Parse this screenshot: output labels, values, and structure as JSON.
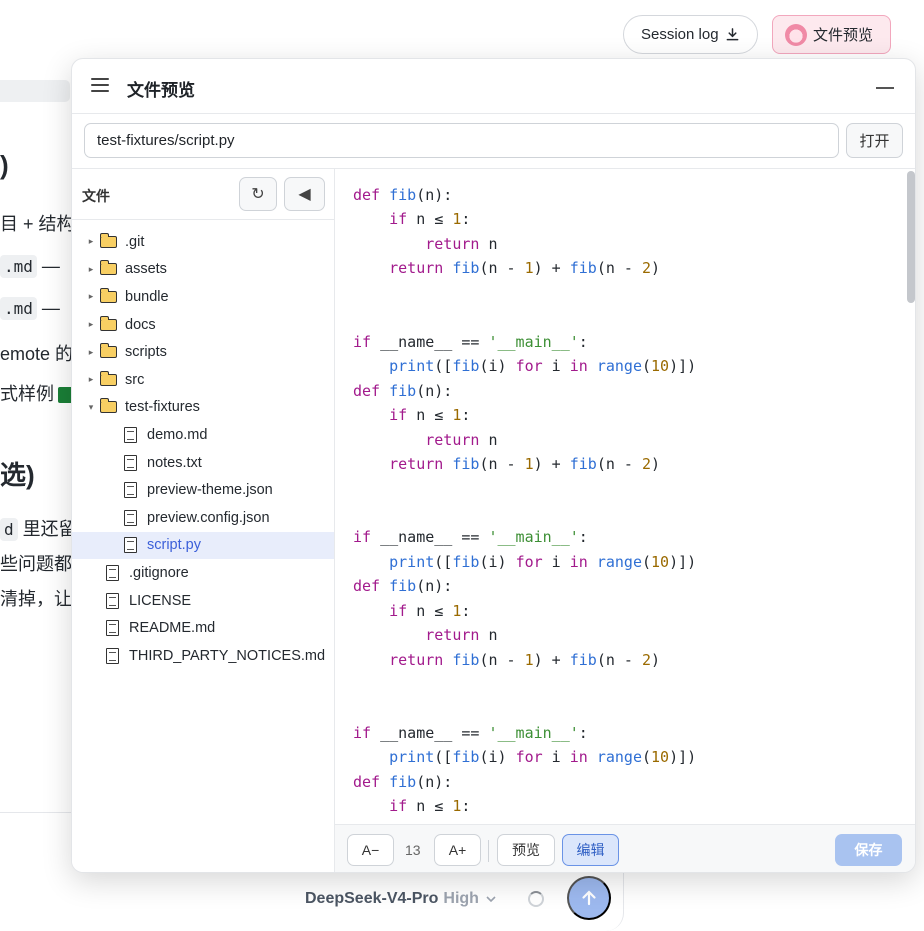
{
  "background": {
    "fragments": [
      {
        "text": ")",
        "style": "heading"
      },
      {
        "text": "目 + 结构",
        "style": "text"
      },
      {
        "text": ".md",
        "style": "code",
        "suffix": " —"
      },
      {
        "text": ".md",
        "style": "code",
        "suffix": " —"
      },
      {
        "text": "emote 的",
        "style": "text"
      },
      {
        "text": "式样例",
        "style": "text"
      },
      {
        "text": "选)",
        "style": "heading"
      },
      {
        "text": "d",
        "style": "code",
        "suffix": " 里还留"
      },
      {
        "text": "些问题都",
        "style": "text"
      },
      {
        "text": "清掉，让",
        "style": "text"
      }
    ]
  },
  "top_bar": {
    "session_log_label": "Session log",
    "preview_label": "文件预览"
  },
  "composer": {
    "model_name": "DeepSeek-V4-Pro",
    "model_level": "High"
  },
  "modal": {
    "title": "文件预览",
    "path_value": "test-fixtures/script.py",
    "open_label": "打开",
    "sidebar": {
      "title": "文件",
      "items": [
        {
          "name": ".git",
          "type": "folder",
          "expanded": false,
          "depth": 0
        },
        {
          "name": "assets",
          "type": "folder",
          "expanded": false,
          "depth": 0
        },
        {
          "name": "bundle",
          "type": "folder",
          "expanded": false,
          "depth": 0
        },
        {
          "name": "docs",
          "type": "folder",
          "expanded": false,
          "depth": 0
        },
        {
          "name": "scripts",
          "type": "folder",
          "expanded": false,
          "depth": 0
        },
        {
          "name": "src",
          "type": "folder",
          "expanded": false,
          "depth": 0
        },
        {
          "name": "test-fixtures",
          "type": "folder",
          "expanded": true,
          "depth": 0
        },
        {
          "name": "demo.md",
          "type": "file",
          "depth": 1
        },
        {
          "name": "notes.txt",
          "type": "file",
          "depth": 1
        },
        {
          "name": "preview-theme.json",
          "type": "file",
          "depth": 1
        },
        {
          "name": "preview.config.json",
          "type": "file",
          "depth": 1
        },
        {
          "name": "script.py",
          "type": "file",
          "depth": 1,
          "selected": true
        },
        {
          "name": ".gitignore",
          "type": "file",
          "depth": 0
        },
        {
          "name": "LICENSE",
          "type": "file",
          "depth": 0
        },
        {
          "name": "README.md",
          "type": "file",
          "depth": 0
        },
        {
          "name": "THIRD_PARTY_NOTICES.md",
          "type": "file",
          "depth": 0
        }
      ]
    },
    "editor": {
      "code_lines": [
        "def fib(n):",
        "    if n ≤ 1:",
        "        return n",
        "    return fib(n - 1) + fib(n - 2)",
        "",
        "",
        "if __name__ == '__main__':",
        "    print([fib(i) for i in range(10)])",
        "def fib(n):",
        "    if n ≤ 1:",
        "        return n",
        "    return fib(n - 1) + fib(n - 2)",
        "",
        "",
        "if __name__ == '__main__':",
        "    print([fib(i) for i in range(10)])",
        "def fib(n):",
        "    if n ≤ 1:",
        "        return n",
        "    return fib(n - 1) + fib(n - 2)",
        "",
        "",
        "if __name__ == '__main__':",
        "    print([fib(i) for i in range(10)])",
        "def fib(n):",
        "    if n ≤ 1:"
      ],
      "footer": {
        "decrease_label": "A−",
        "font_size": "13",
        "increase_label": "A+",
        "preview_label": "预览",
        "edit_label": "编辑",
        "save_label": "保存"
      }
    }
  },
  "colors": {
    "accent": "#3b5fd9",
    "selected_row": "#e8edfb",
    "save_disabled": "#a9c3f0",
    "keyword": "#a21a8c",
    "function": "#2f6fd4",
    "number": "#9a6a00",
    "string": "#3d8f35"
  }
}
